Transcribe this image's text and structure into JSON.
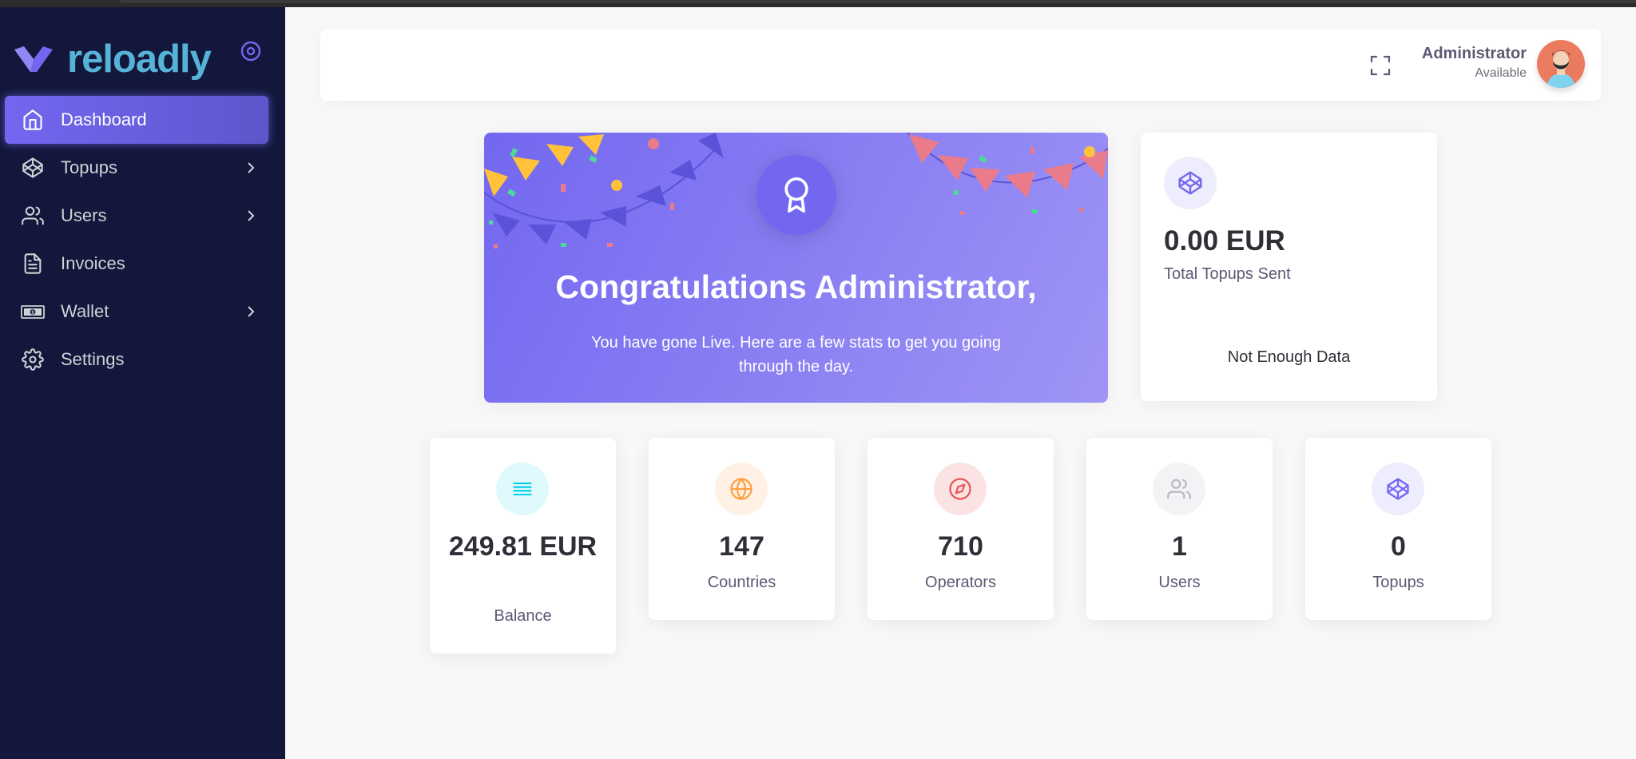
{
  "app": {
    "brand_name": "reloadly",
    "accent": "#7367f0",
    "sidebar_bg": "#12173b"
  },
  "sidebar": {
    "items": [
      {
        "label": "Dashboard",
        "icon": "home-icon",
        "active": true,
        "has_submenu": false
      },
      {
        "label": "Topups",
        "icon": "codepen-icon",
        "active": false,
        "has_submenu": true
      },
      {
        "label": "Users",
        "icon": "users-icon",
        "active": false,
        "has_submenu": true
      },
      {
        "label": "Invoices",
        "icon": "file-text-icon",
        "active": false,
        "has_submenu": false
      },
      {
        "label": "Wallet",
        "icon": "banknote-icon",
        "active": false,
        "has_submenu": true
      },
      {
        "label": "Settings",
        "icon": "gear-icon",
        "active": false,
        "has_submenu": false
      }
    ]
  },
  "header": {
    "user_name": "Administrator",
    "user_status": "Available"
  },
  "congrats": {
    "title": "Congratulations Administrator,",
    "text": "You have gone Live. Here are a few stats to get you going through the day."
  },
  "topups_sent": {
    "value": "0.00 EUR",
    "label": "Total Topups Sent",
    "empty_message": "Not Enough Data"
  },
  "stats": [
    {
      "value": "249.81 EUR",
      "label": "Balance",
      "icon": "list-icon",
      "color": "#00cfe8"
    },
    {
      "value": "147",
      "label": "Countries",
      "icon": "globe-icon",
      "color": "#ff9f43"
    },
    {
      "value": "710",
      "label": "Operators",
      "icon": "compass-icon",
      "color": "#ea5455"
    },
    {
      "value": "1",
      "label": "Users",
      "icon": "users-icon",
      "color": "#b9b9c3"
    },
    {
      "value": "0",
      "label": "Topups",
      "icon": "codepen-icon",
      "color": "#7367f0"
    }
  ]
}
